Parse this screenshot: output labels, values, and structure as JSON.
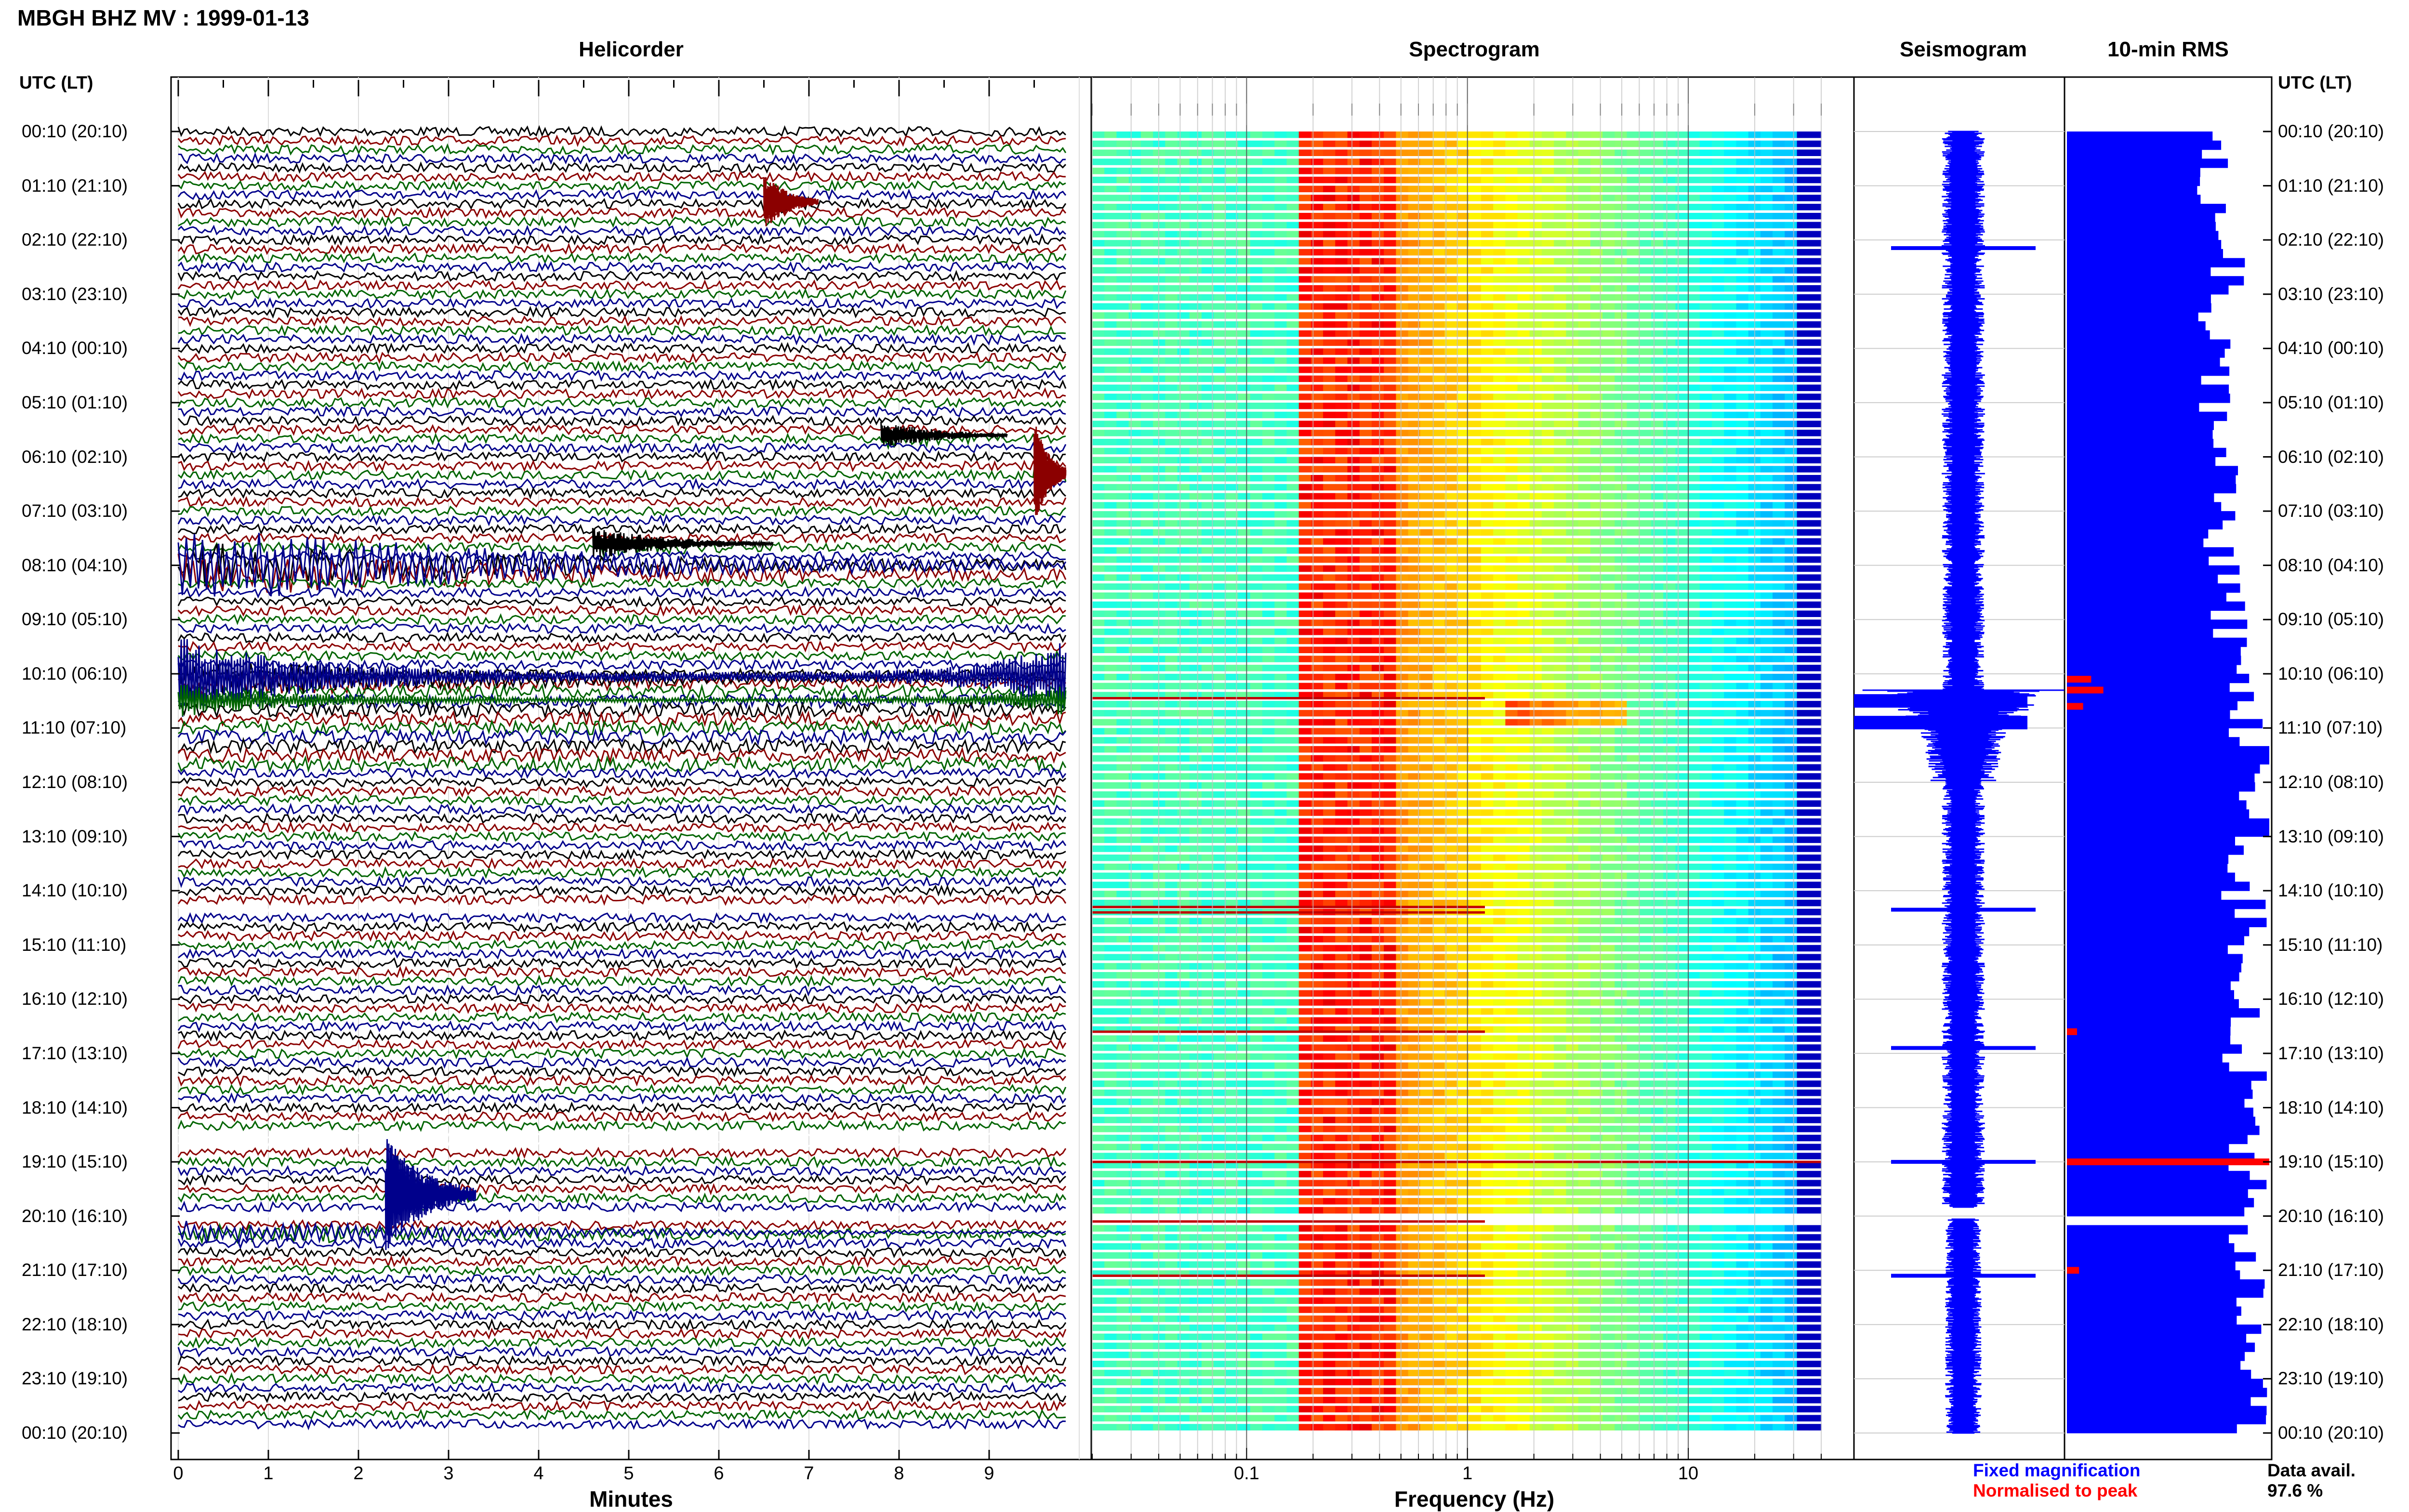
{
  "page": {
    "title": "MBGH BHZ MV : 1999-01-13",
    "axis_header": "UTC (LT)",
    "footer": {
      "fixed_label": "Fixed magnification",
      "normalised_label": "Normalised to peak",
      "data_avail_label": "Data avail.",
      "data_avail_value": "97.6 %"
    }
  },
  "colors": {
    "trace_cycle": [
      "#000000",
      "#8b0000",
      "#006400",
      "#00008b"
    ],
    "seismogram": "#0000ff",
    "rms_fixed": "#0000ff",
    "rms_normalised": "#ff0000"
  },
  "chart_data": [
    {
      "type": "line",
      "name": "helicorder",
      "title": "Helicorder",
      "xlabel": "Minutes",
      "ylabel": "",
      "x_ticks": [
        "0",
        "1",
        "2",
        "3",
        "4",
        "5",
        "6",
        "7",
        "8",
        "9"
      ],
      "xlim": [
        0,
        10
      ],
      "rows_per_hour": 6,
      "row_minutes": 10,
      "y_labels": [
        "00:10 (20:10)",
        "01:10 (21:10)",
        "02:10 (22:10)",
        "03:10 (23:10)",
        "04:10 (00:10)",
        "05:10 (01:10)",
        "06:10 (02:10)",
        "07:10 (03:10)",
        "08:10 (04:10)",
        "09:10 (05:10)",
        "10:10 (06:10)",
        "11:10 (07:10)",
        "12:10 (08:10)",
        "13:10 (09:10)",
        "14:10 (10:10)",
        "15:10 (11:10)",
        "16:10 (12:10)",
        "17:10 (13:10)",
        "18:10 (14:10)",
        "19:10 (15:10)",
        "20:10 (16:10)",
        "21:10 (17:10)",
        "22:10 (18:10)",
        "23:10 (19:10)",
        "00:10 (20:10)"
      ],
      "events": [
        {
          "start_hour": 1.3,
          "minute": 6.5,
          "duration_min": 0.6,
          "amp": 3.2,
          "color": "#8b0000"
        },
        {
          "start_hour": 5.6,
          "minute": 7.8,
          "duration_min": 1.4,
          "amp": 1.6,
          "color": "#000000"
        },
        {
          "start_hour": 7.6,
          "minute": 4.6,
          "duration_min": 2.0,
          "amp": 1.8,
          "color": "#000000"
        },
        {
          "start_hour": 6.3,
          "minute": 9.5,
          "duration_min": 0.5,
          "amp": 6.0,
          "color": "#8b0000"
        },
        {
          "start_hour": 8.0,
          "minute": 0.0,
          "duration_min": 10.0,
          "amp": 4.5,
          "color": "#00008b"
        },
        {
          "start_hour": 10.1,
          "minute": 0.0,
          "duration_min": 10.0,
          "amp": 2.2,
          "color": "#000000"
        },
        {
          "start_hour": 19.6,
          "minute": 2.3,
          "duration_min": 1.0,
          "amp": 6.5,
          "color": "#00008b"
        },
        {
          "start_hour": 20.3,
          "minute": 0.0,
          "duration_min": 10.0,
          "amp": 1.4,
          "color": "#00008b"
        }
      ],
      "gaps": [
        {
          "start_hour": 14.3,
          "end_hour": 14.45
        },
        {
          "start_hour": 18.5,
          "end_hour": 18.75
        },
        {
          "start_hour": 19.85,
          "end_hour": 20.0
        }
      ]
    },
    {
      "type": "heatmap",
      "name": "spectrogram",
      "title": "Spectrogram",
      "xlabel": "Frequency (Hz)",
      "ylabel": "",
      "x_scale": "log",
      "xlim": [
        0.02,
        40
      ],
      "x_ticks": [
        0.1,
        1,
        10
      ],
      "x_tick_labels": [
        "0.1",
        "1",
        "10"
      ],
      "peak_band_hz": [
        0.17,
        0.5
      ],
      "gap_hours": [
        [
          19.9,
          20.1
        ]
      ]
    },
    {
      "type": "line",
      "name": "seismogram",
      "title": "Seismogram",
      "series": [
        {
          "name": "Fixed magnification",
          "color": "#0000ff"
        }
      ],
      "bursts_hour": [
        2.15,
        10.5,
        10.9,
        14.35,
        16.9,
        19.0,
        21.1
      ],
      "gap_hours": [
        [
          19.85,
          20.05
        ]
      ]
    },
    {
      "type": "bar",
      "name": "rms",
      "title": "10-min RMS",
      "orientation": "horizontal",
      "series": [
        {
          "name": "Fixed magnification",
          "color": "#0000ff"
        },
        {
          "name": "Normalised to peak",
          "color": "#ff0000"
        }
      ],
      "xlim": [
        0,
        1
      ],
      "hourly_level": [
        0.78,
        0.8,
        0.86,
        0.78,
        0.79,
        0.78,
        0.84,
        0.8,
        0.86,
        0.88,
        0.94,
        1.0,
        0.98,
        0.92,
        0.96,
        0.9,
        0.92,
        0.96,
        0.95,
        0.98,
        0.92,
        0.95,
        0.94,
        0.96
      ],
      "gap_hours": [
        [
          19.85,
          20.05
        ]
      ],
      "red_peaks": [
        {
          "hour": 10.1,
          "level": 0.12
        },
        {
          "hour": 10.3,
          "level": 0.18
        },
        {
          "hour": 10.6,
          "level": 0.08
        },
        {
          "hour": 16.6,
          "level": 0.05
        },
        {
          "hour": 19.0,
          "level": 1.0
        },
        {
          "hour": 21.0,
          "level": 0.06
        }
      ]
    }
  ]
}
